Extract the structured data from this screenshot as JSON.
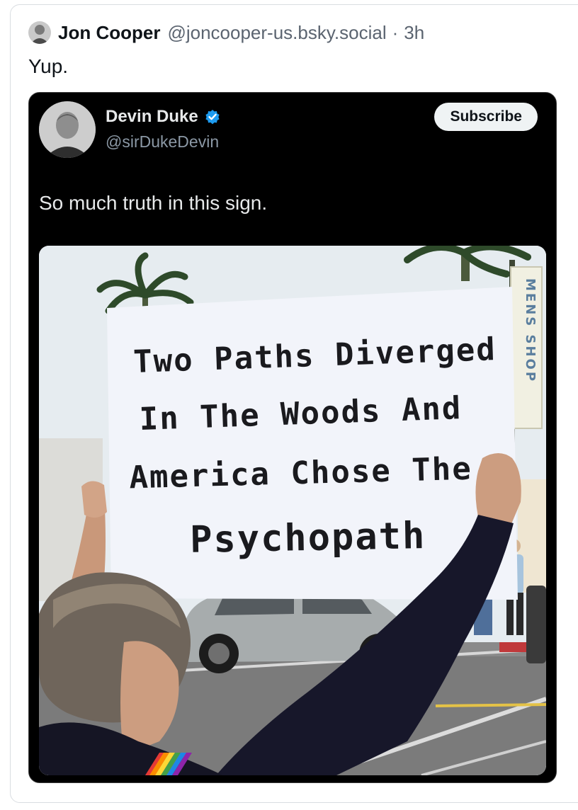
{
  "post": {
    "author_name": "Jon Cooper",
    "author_handle": "@joncooper-us.bsky.social",
    "separator": "·",
    "time": "3h",
    "text": "Yup."
  },
  "embed": {
    "author_name": "Devin Duke",
    "author_handle": "@sirDukeDevin",
    "subscribe_label": "Subscribe",
    "text": "So much truth in this sign.",
    "sign_lines": [
      "Two Paths Diverged",
      "In The Woods And",
      "America Chose The",
      "Psychopath"
    ],
    "store_sign": "MENS SHOP"
  },
  "colors": {
    "verified": "#1d9bf0",
    "embed_bg": "#000000",
    "sign": "#f2f4fa",
    "ink": "#1a1a1e"
  },
  "icons": [
    "verified-badge-icon"
  ]
}
